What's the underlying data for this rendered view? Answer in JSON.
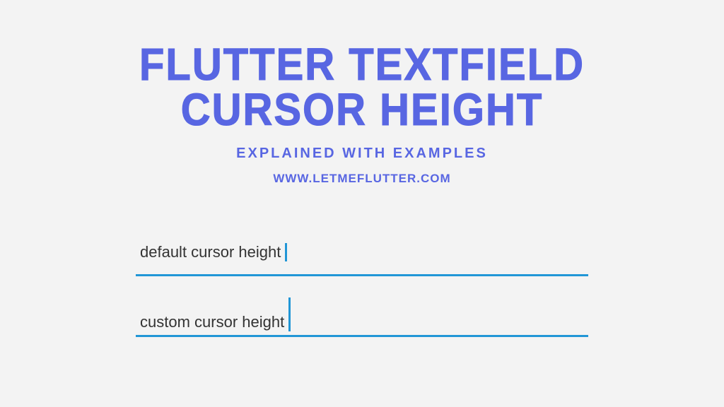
{
  "header": {
    "title_line1": "FLUTTER TEXTFIELD",
    "title_line2": "CURSOR HEIGHT",
    "subtitle": "EXPLAINED WITH EXAMPLES",
    "url": "WWW.LETMEFLUTTER.COM"
  },
  "examples": {
    "field1": {
      "label": "default cursor height"
    },
    "field2": {
      "label": "custom cursor height"
    }
  }
}
